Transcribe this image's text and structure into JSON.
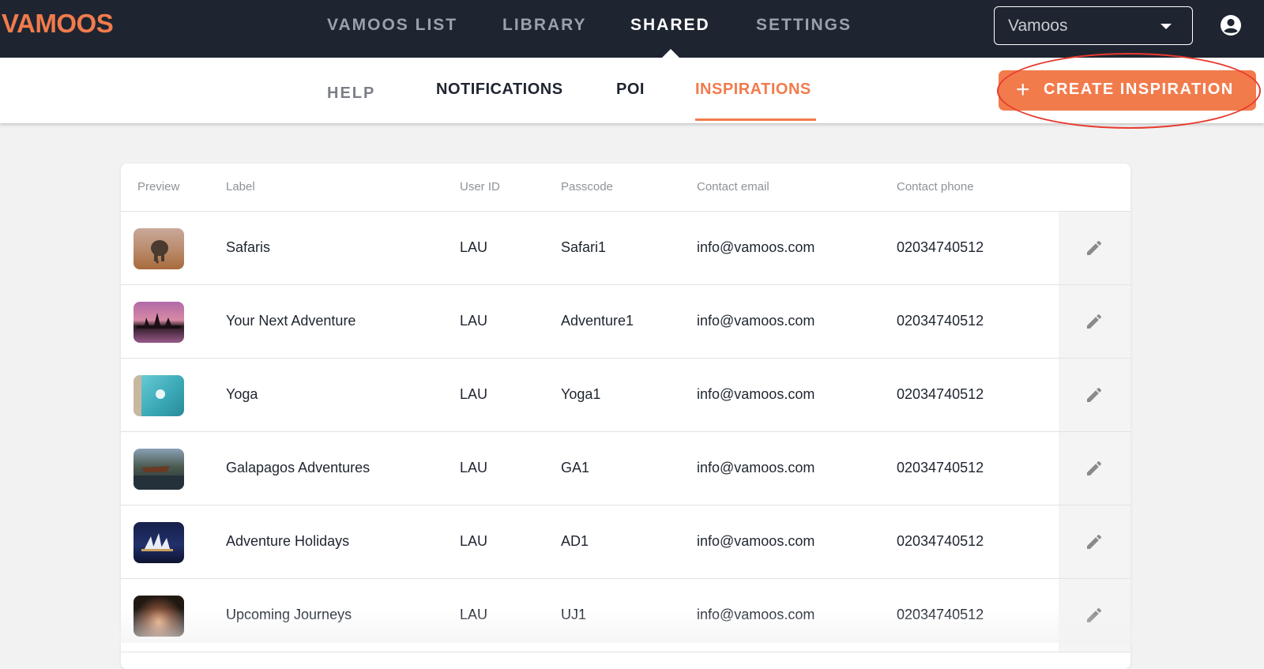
{
  "app": {
    "logo_text": "VAMOOS",
    "accent_color": "#f27b4c",
    "header_color": "#1e2530"
  },
  "main_nav": {
    "items": [
      {
        "label": "VAMOOS LIST",
        "active": false
      },
      {
        "label": "LIBRARY",
        "active": false
      },
      {
        "label": "SHARED",
        "active": true
      },
      {
        "label": "SETTINGS",
        "active": false
      }
    ]
  },
  "account_select": {
    "selected": "Vamoos"
  },
  "header_icons": {
    "user": "account-circle-icon"
  },
  "sub_nav": {
    "items": [
      {
        "label": "HELP",
        "active": false
      },
      {
        "label": "NOTIFICATIONS",
        "active": false
      },
      {
        "label": "POI",
        "active": false
      },
      {
        "label": "INSPIRATIONS",
        "active": true
      }
    ]
  },
  "create_button": {
    "icon": "plus-icon",
    "label": "CREATE INSPIRATION"
  },
  "table": {
    "columns": [
      "Preview",
      "Label",
      "User ID",
      "Passcode",
      "Contact email",
      "Contact phone"
    ],
    "rows": [
      {
        "label": "Safaris",
        "user_id": "LAU",
        "passcode": "Safari1",
        "email": "info@vamoos.com",
        "phone": "02034740512",
        "preview": "elephant-savanna-thumbnail"
      },
      {
        "label": "Your Next Adventure",
        "user_id": "LAU",
        "passcode": "Adventure1",
        "email": "info@vamoos.com",
        "phone": "02034740512",
        "preview": "temple-sunset-thumbnail"
      },
      {
        "label": "Yoga",
        "user_id": "LAU",
        "passcode": "Yoga1",
        "email": "info@vamoos.com",
        "phone": "02034740512",
        "preview": "turquoise-water-thumbnail"
      },
      {
        "label": "Galapagos Adventures",
        "user_id": "LAU",
        "passcode": "GA1",
        "email": "info@vamoos.com",
        "phone": "02034740512",
        "preview": "boat-landscape-thumbnail"
      },
      {
        "label": "Adventure Holidays",
        "user_id": "LAU",
        "passcode": "AD1",
        "email": "info@vamoos.com",
        "phone": "02034740512",
        "preview": "opera-house-night-thumbnail"
      },
      {
        "label": "Upcoming Journeys",
        "user_id": "LAU",
        "passcode": "UJ1",
        "email": "info@vamoos.com",
        "phone": "02034740512",
        "preview": "cave-arch-thumbnail"
      }
    ],
    "row_action_icon": "pencil-edit-icon"
  }
}
